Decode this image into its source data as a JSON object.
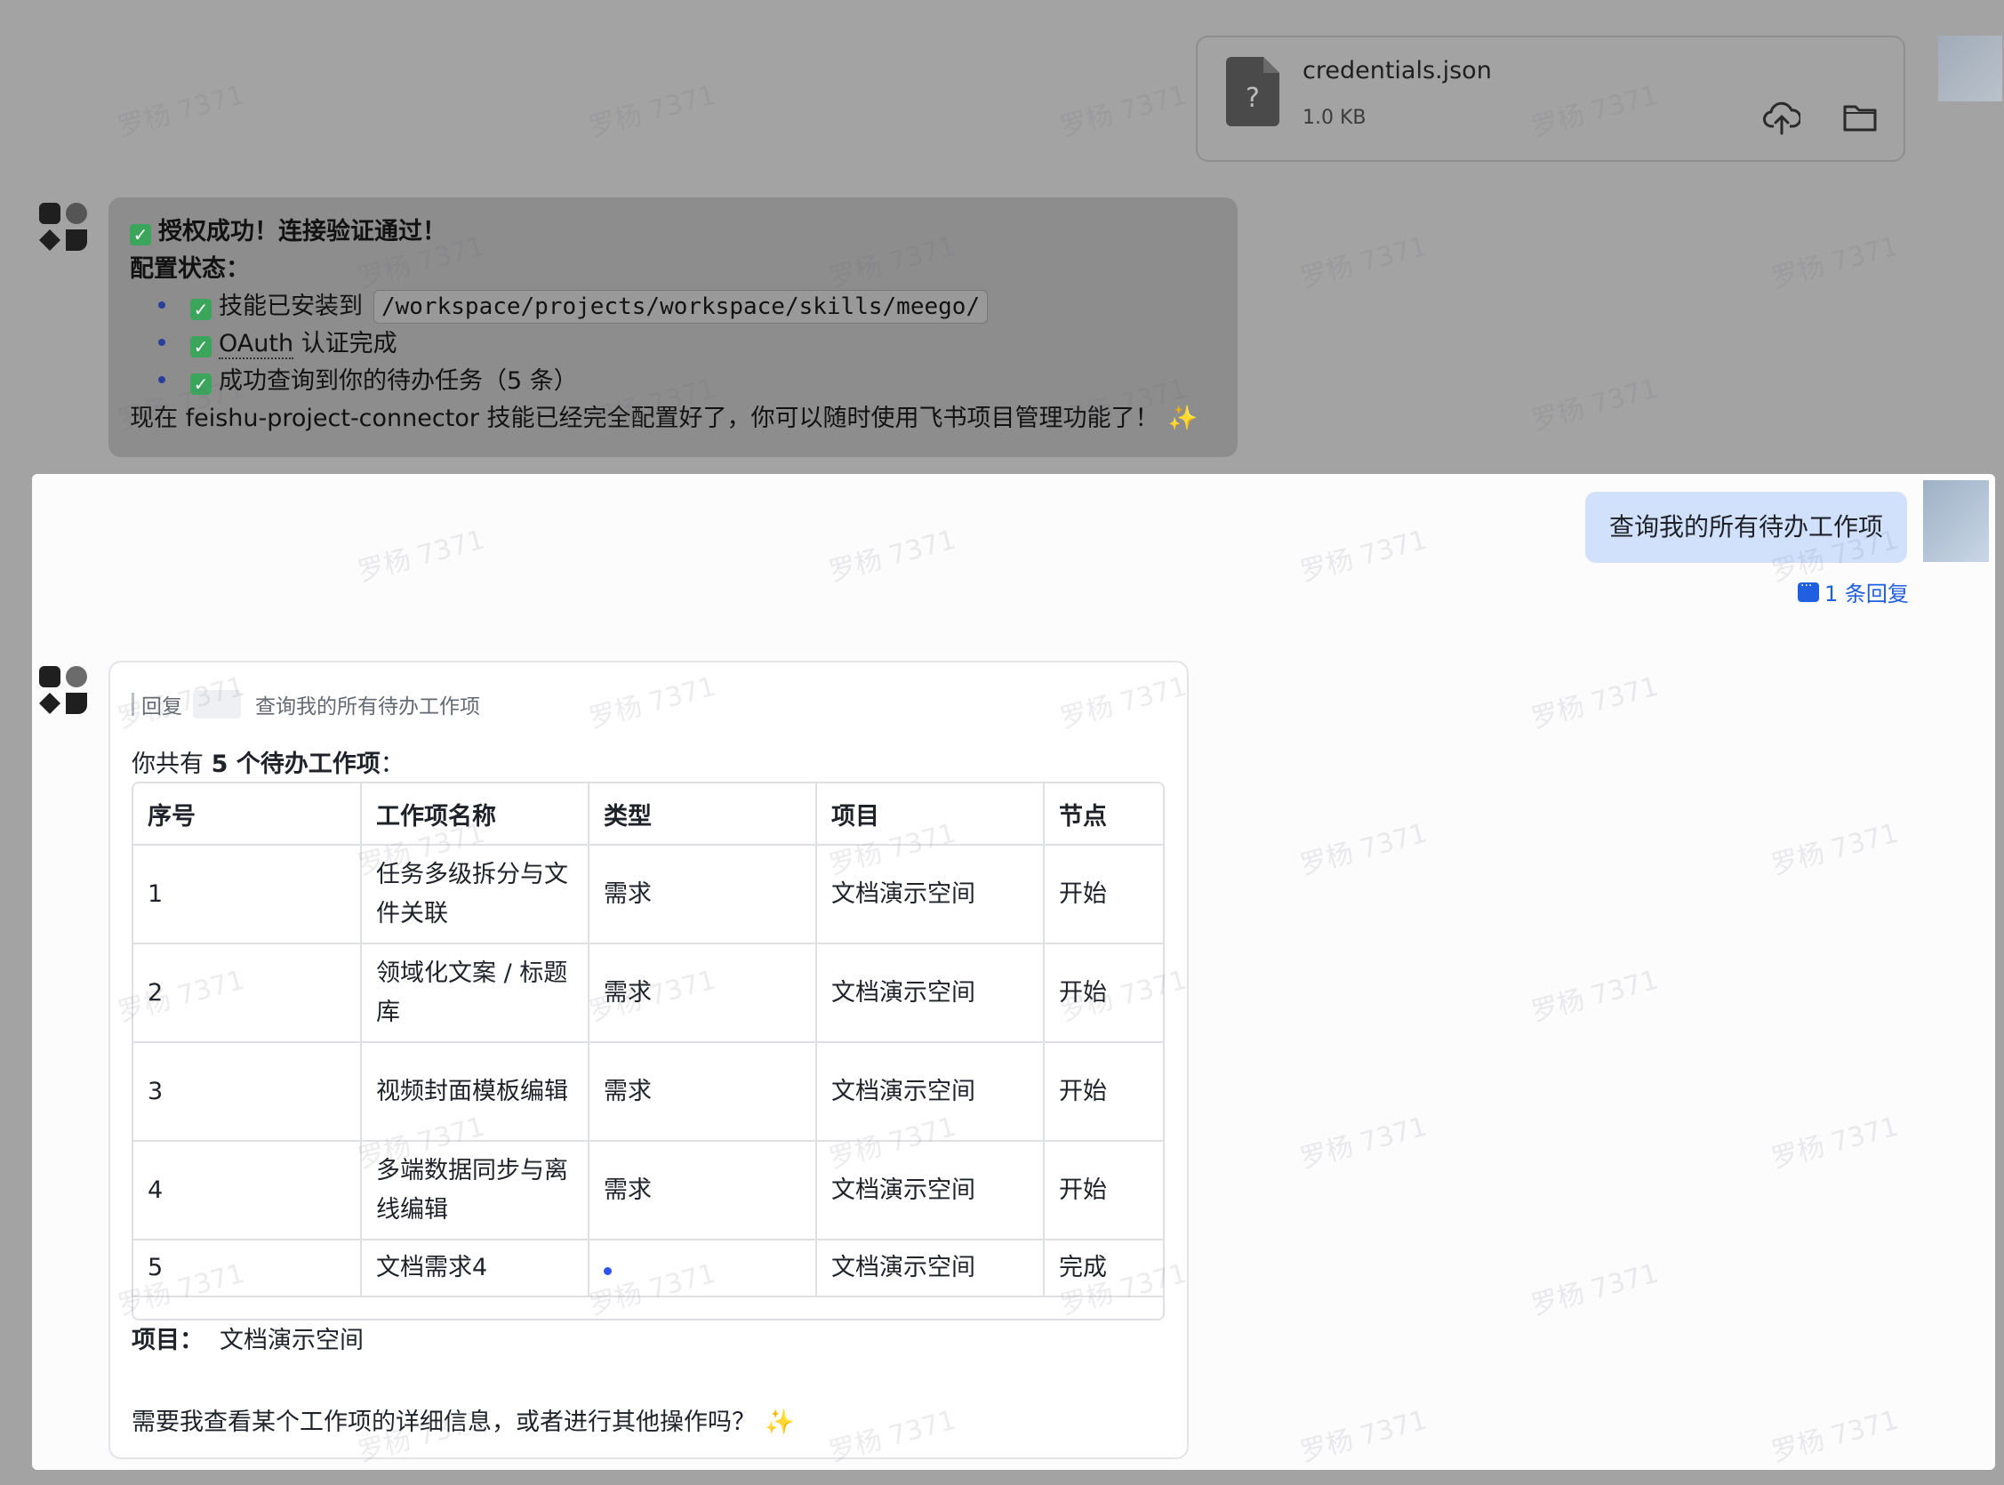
{
  "file_card": {
    "name": "credentials.json",
    "size": "1.0 KB",
    "file_icon_glyph": "?"
  },
  "bot_message_1": {
    "title": "授权成功！连接验证通过！",
    "config_label": "配置状态：",
    "items": [
      {
        "text": "技能已安装到",
        "code": "/workspace/projects/workspace/skills/meego/"
      },
      {
        "text_prefix": "OAuth",
        "text": " 认证完成"
      },
      {
        "text": "成功查询到你的待办任务（5 条）"
      }
    ],
    "closing": "现在 feishu-project-connector 技能已经完全配置好了，你可以随时使用飞书项目管理功能了！",
    "closing_emoji": "✨"
  },
  "user_message": {
    "text": "查询我的所有待办工作项",
    "reply_count": "1 条回复"
  },
  "bot_message_2": {
    "quote_label": "回复",
    "quote_text": "查询我的所有待办工作项",
    "summary_prefix": "你共有",
    "summary_bold": "5 个待办工作项",
    "summary_suffix": "：",
    "table": {
      "headers": [
        "序号",
        "工作项名称",
        "类型",
        "项目",
        "节点"
      ],
      "rows": [
        [
          "1",
          "任务多级拆分与文件关联",
          "需求",
          "文档演示空间",
          "开始"
        ],
        [
          "2",
          "领域化文案 / 标题库",
          "需求",
          "文档演示空间",
          "开始"
        ],
        [
          "3",
          "视频封面模板编辑",
          "需求",
          "文档演示空间",
          "开始"
        ],
        [
          "4",
          "多端数据同步与离线编辑",
          "需求",
          "文档演示空间",
          "开始"
        ],
        [
          "5",
          "文档需求4",
          "",
          "文档演示空间",
          "完成"
        ]
      ]
    },
    "project_label": "项目：",
    "project_value": "文档演示空间",
    "closing": "需要我查看某个工作项的详细信息，或者进行其他操作吗？",
    "closing_emoji": "✨"
  },
  "watermark": "罗杨 7371",
  "colors": {
    "overlay": "#a3a3a3",
    "user_bubble": "#d1e1fb",
    "link": "#1f5fe0",
    "check": "#3ba55c"
  }
}
